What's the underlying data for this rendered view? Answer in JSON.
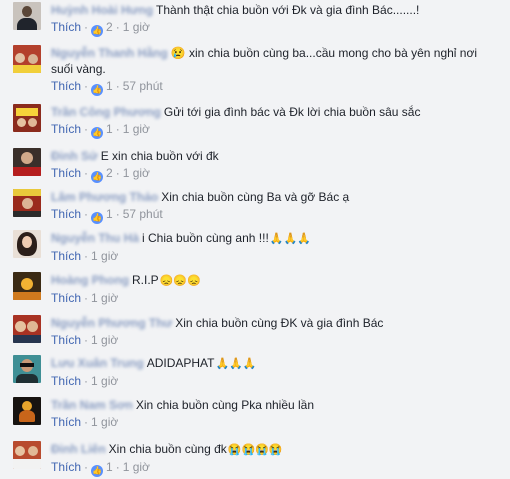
{
  "ui": {
    "like_label": "Thích",
    "separator": "·",
    "reaction_icon": "thumbs-up-icon",
    "accent": "#4267b2"
  },
  "comments": [
    {
      "author": "Huỳnh Hoài Hưng",
      "text": "Thành thật chia buồn với Đk và gia đình Bác.......!",
      "emoji": "",
      "reactions": "2",
      "time": "1 giờ"
    },
    {
      "author": "Nguyễn Thanh Hằng",
      "text": "😢 xin chia buồn cùng ba...cầu mong cho bà yên nghỉ nơi suối vàng.",
      "emoji": "",
      "reactions": "1",
      "time": "57 phút"
    },
    {
      "author": "Trần Công Phương",
      "text": "Gửi tới gia đình bác và Đk lời chia buồn sâu sắc",
      "emoji": "",
      "reactions": "1",
      "time": "1 giờ"
    },
    {
      "author": "Đinh Sử",
      "text": "E xin chia buồn với đk",
      "emoji": "",
      "reactions": "2",
      "time": "1 giờ"
    },
    {
      "author": "Lâm Phương Thảo",
      "text": "Xin chia buồn cùng Ba và gỡ Bác ạ",
      "emoji": "",
      "reactions": "1",
      "time": "57 phút"
    },
    {
      "author": "Nguyễn Thu Hà",
      "text": "i Chia buồn cùng anh !!!",
      "emoji": "🙏🙏🙏",
      "reactions": "",
      "time": "1 giờ"
    },
    {
      "author": "Hoàng Phong",
      "text": "R.I.P",
      "emoji": "😞😞😞",
      "reactions": "",
      "time": "1 giờ"
    },
    {
      "author": "Nguyễn Phương Thư",
      "text": "Xin chia buồn cùng ĐK và gia đình Bác",
      "emoji": "",
      "reactions": "",
      "time": "1 giờ"
    },
    {
      "author": "Lưu Xuân Trung",
      "text": "ADIDAPHAT",
      "emoji": "🙏🙏🙏",
      "reactions": "",
      "time": "1 giờ"
    },
    {
      "author": "Trần Nam Sơn",
      "text": "Xin chia buồn cùng Pka nhiều lần",
      "emoji": "",
      "reactions": "",
      "time": "1 giờ"
    },
    {
      "author": "Đinh Liên",
      "text": "Xin chia buồn cùng đk",
      "emoji": "😭😭😭😭",
      "reactions": "1",
      "time": "1 giờ"
    }
  ]
}
